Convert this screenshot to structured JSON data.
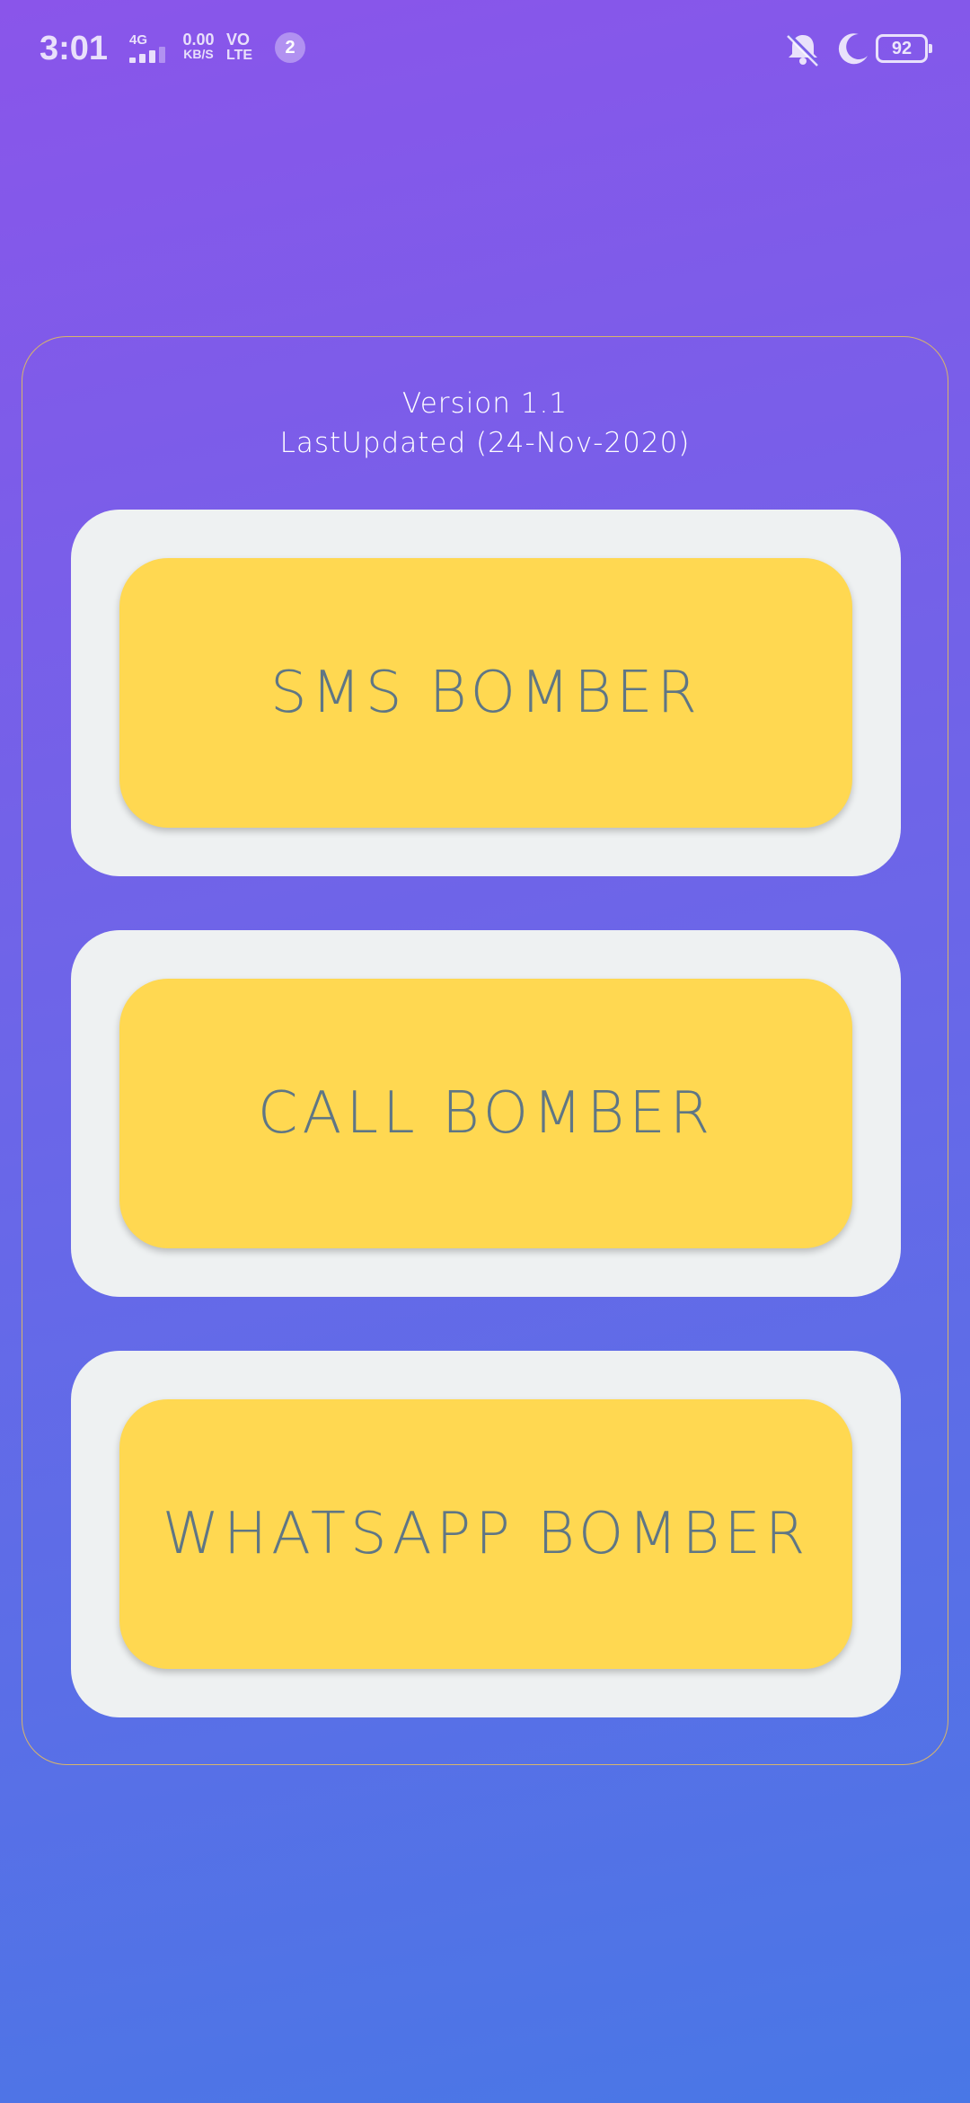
{
  "status_bar": {
    "time": "3:01",
    "network_type": "4G",
    "speed_value": "0.00",
    "speed_unit": "KB/S",
    "volte_top": "VO",
    "volte_bottom": "LTE",
    "notification_count": "2",
    "battery_level": "92",
    "icons": [
      "signal-icon",
      "bell-muted-icon",
      "moon-icon",
      "battery-icon"
    ]
  },
  "app": {
    "version_text": "Version 1.1",
    "last_updated_text": "LastUpdated (24-Nov-2020)",
    "buttons": [
      {
        "label": "SMS BOMBER"
      },
      {
        "label": "CALL BOMBER"
      },
      {
        "label": "WHATSAPP BOMBER"
      }
    ]
  },
  "colors": {
    "background_top": "#8a55ea",
    "background_bottom": "#4977e6",
    "card_border": "#d8b56a",
    "frame": "#eef1f2",
    "button": "#ffd851",
    "button_text": "#5f7685"
  }
}
